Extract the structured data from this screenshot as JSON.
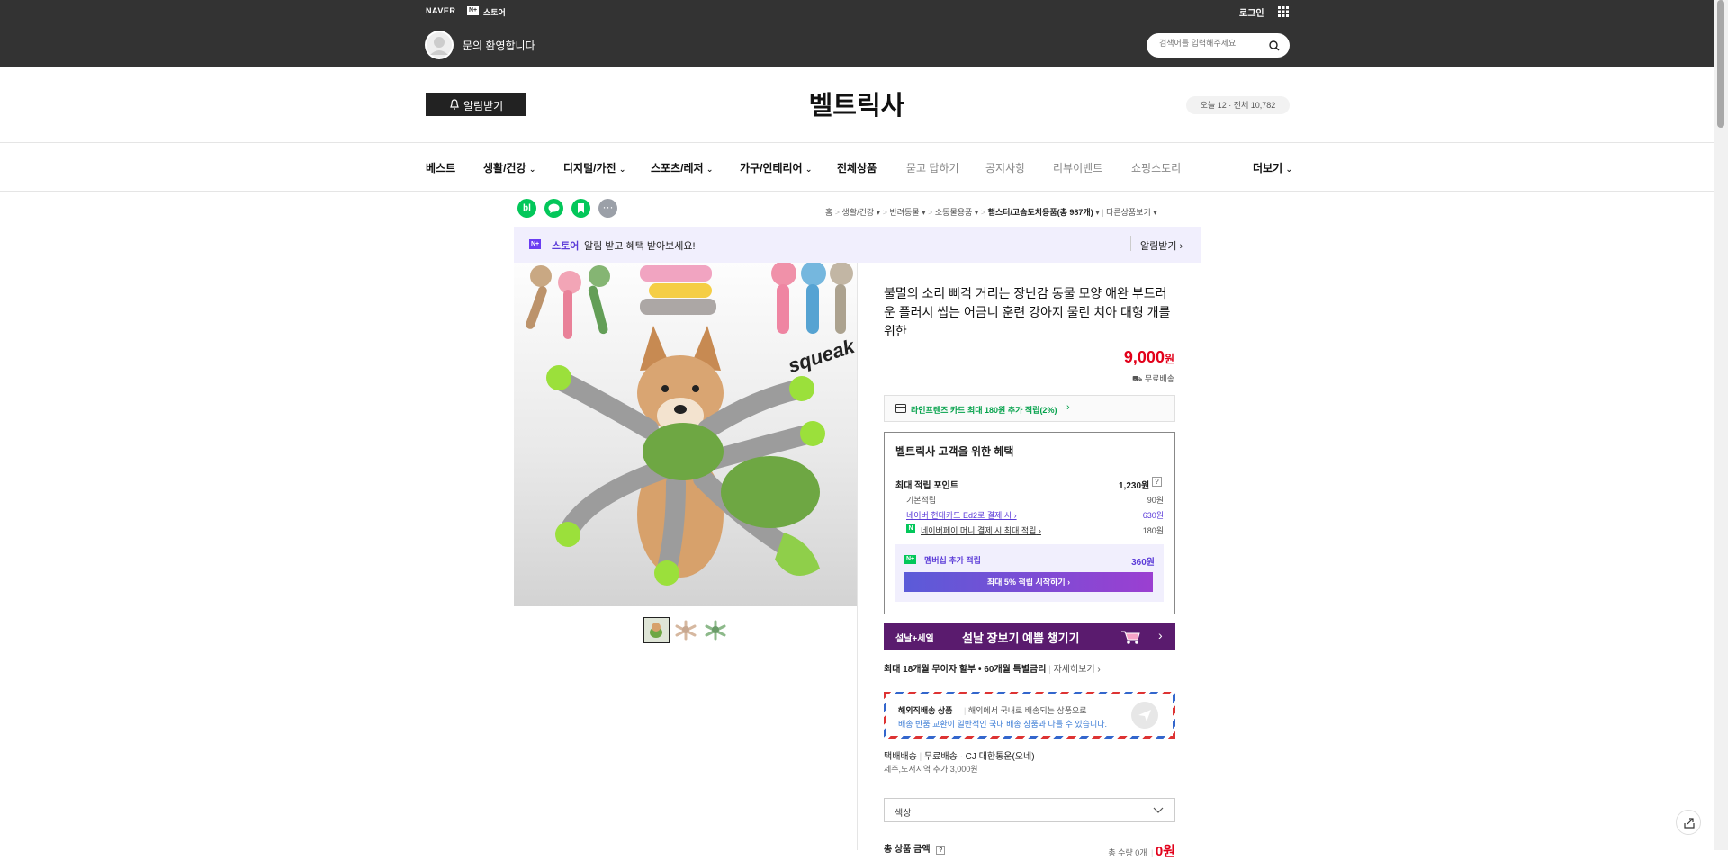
{
  "topbar": {
    "naver": "NAVER",
    "store_badge": "N+",
    "store": "스토어",
    "login": "로그인",
    "welcome": "문의 환영합니다",
    "search_placeholder": "검색어를 입력해주세요"
  },
  "header": {
    "alarm": "알림받기",
    "store_name": "벨트릭사",
    "visitors": "오늘 12 · 전체 10,782"
  },
  "nav": {
    "items": [
      "베스트",
      "생활/건강",
      "디지털/가전",
      "스포츠/레저",
      "가구/인테리어",
      "전체상품",
      "묻고 답하기",
      "공지사항",
      "리뷰이벤트",
      "쇼핑스토리"
    ],
    "more": "더보기"
  },
  "breadcrumb": [
    "홈",
    "생활/건강",
    "반려동물",
    "소동물용품",
    "햄스터/고슴도치용품(총 987개)",
    "다른상품보기"
  ],
  "noti_banner": {
    "badge": "N+",
    "store": "스토어",
    "text": "알림 받고 혜택 받아보세요!",
    "action": "알림받기"
  },
  "product": {
    "image_text": "squeak",
    "title": "불멸의 소리 삐걱 거리는 장난감 동물 모양 애완 부드러운 플러시 씹는 어금니 훈련 강아지 물린 치아 대형 개를위한",
    "price": "9,000",
    "won": "원",
    "ship_badge": "무료배송",
    "card_promo": "라인프렌즈 카드 최대 180원 추가 적립(2%)",
    "benefit": {
      "title": "벨트릭사 고객을 위한 혜택",
      "max_label": "최대 적립 포인트",
      "max_value": "1,230원",
      "rows": [
        {
          "label": "기본적립",
          "value": "90원"
        },
        {
          "label": "네이버 현대카드 Ed2로 결제 시",
          "value": "630원"
        },
        {
          "label": "네이버페이 머니 결제 시 최대 적립",
          "value": "180원"
        }
      ],
      "membership_label": "멤버십 추가 적립",
      "membership_value": "360원",
      "start_btn": "최대 5% 적립 시작하기"
    },
    "sale_banner": {
      "tag": "설날+세일",
      "text": "설날 장보기 예쁨 챙기기"
    },
    "installment": "최대 18개월 무이자 할부 • 60개월 특별금리",
    "installment_link": "자세히보기",
    "overseas": {
      "title": "해외직배송 상품",
      "desc1": "해외에서 국내로 배송되는 상품으로",
      "desc2": "배송 반품 교환이 일반적인 국내 배송 상품과 다를 수 있습니다."
    },
    "delivery_label": "택배배송",
    "delivery_value": "무료배송 · CJ 대한통운(오네)",
    "delivery_extra": "제주,도서지역 추가 3,000원",
    "option": "색상",
    "total_label": "총 상품 금액",
    "total_qty": "총 수량 0개",
    "total_price": "0원"
  },
  "colors": {
    "topbar": "#333333",
    "price": "#e2001a",
    "green": "#03c75a",
    "purple": "#5c2d91",
    "sale": "#5a1b6e"
  }
}
